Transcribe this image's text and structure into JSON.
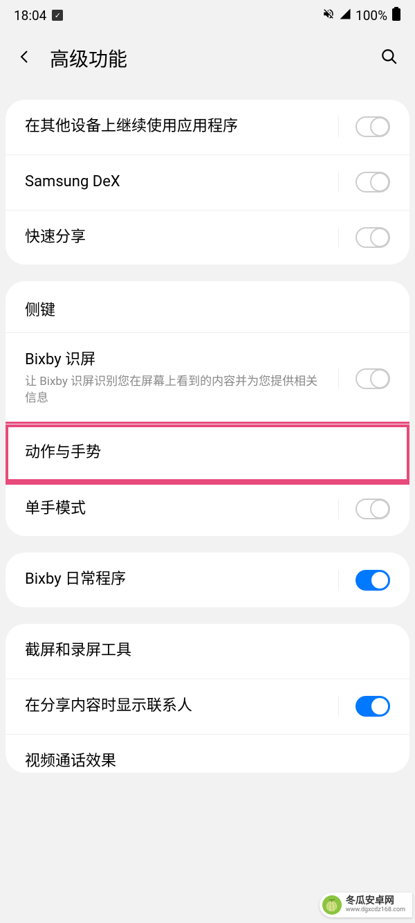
{
  "statusBar": {
    "time": "18:04",
    "battery": "100%"
  },
  "header": {
    "title": "高级功能"
  },
  "sections": [
    {
      "rows": [
        {
          "title": "在其他设备上继续使用应用程序",
          "toggle": "off"
        },
        {
          "title": "Samsung DeX",
          "toggle": "off"
        },
        {
          "title": "快速分享",
          "toggle": "off"
        }
      ]
    },
    {
      "header": "侧键",
      "rows": [
        {
          "title": "Bixby 识屏",
          "subtitle": "让 Bixby 识屏识别您在屏幕上看到的内容并为您提供相关信息",
          "toggle": "off"
        },
        {
          "title": "动作与手势",
          "highlighted": true
        },
        {
          "title": "单手模式",
          "toggle": "off"
        }
      ]
    },
    {
      "rows": [
        {
          "title": "Bixby 日常程序",
          "toggle": "on"
        }
      ]
    },
    {
      "rows": [
        {
          "title": "截屏和录屏工具"
        },
        {
          "title": "在分享内容时显示联系人",
          "toggle": "on"
        },
        {
          "title": "视频通话效果",
          "cut": true
        }
      ]
    }
  ],
  "watermark": {
    "name": "冬瓜安卓网",
    "url": "www.dgxcdz168.com"
  }
}
